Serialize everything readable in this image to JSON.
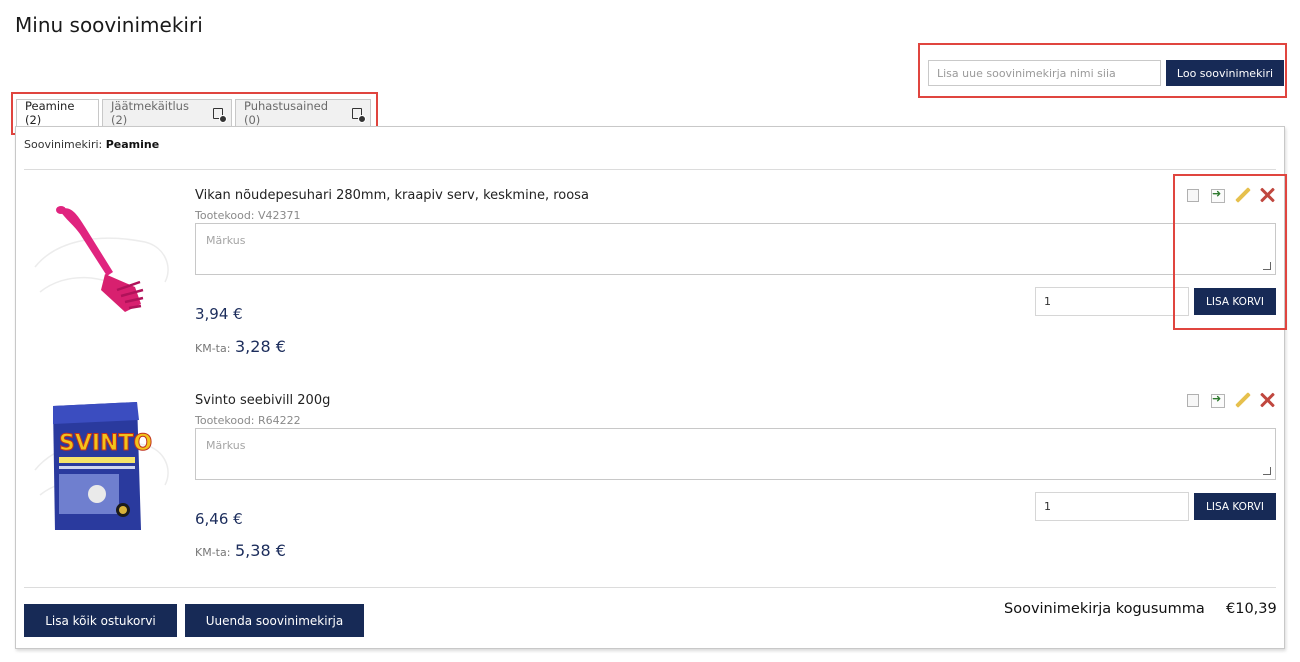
{
  "page": {
    "title": "Minu soovinimekiri"
  },
  "create": {
    "placeholder": "Lisa uue soovinimekirja nimi siia",
    "button_label": "Loo soovinimekiri"
  },
  "tabs": [
    {
      "label": "Peamine (2)",
      "active": true,
      "icon": null
    },
    {
      "label": "Jäätmekäitlus (2)",
      "active": false,
      "icon": "list-settings-icon"
    },
    {
      "label": "Puhastusained (0)",
      "active": false,
      "icon": "list-settings-icon"
    }
  ],
  "list": {
    "label_prefix": "Soovinimekiri:",
    "name": "Peamine"
  },
  "products": [
    {
      "name": "Vikan nõudepesuhari 280mm, kraapiv serv, keskmine, roosa",
      "code": "Tootekood: V42371",
      "note_placeholder": "Märkus",
      "price": "3,94 €",
      "net_label": "KM-ta:",
      "net_price": "3,28 €",
      "quantity": "1",
      "cart_label": "LISA KORVI",
      "image": "pink-dish-brush"
    },
    {
      "name": "Svinto seebivill 200g",
      "code": "Tootekood: R64222",
      "note_placeholder": "Märkus",
      "price": "6,46 €",
      "net_label": "KM-ta:",
      "net_price": "5,38 €",
      "quantity": "1",
      "cart_label": "LISA KORVI",
      "image": "svinto-box",
      "image_text": "SVINTO"
    }
  ],
  "footer": {
    "add_all_label": "Lisa kõik ostukorvi",
    "update_label": "Uuenda soovinimekirja",
    "total_label": "Soovinimekirja kogusumma",
    "total_value": "€10,39"
  },
  "colors": {
    "primary": "#172a56",
    "price": "#1c2d5c",
    "highlight": "#e0453f",
    "delete": "#c0473f"
  }
}
